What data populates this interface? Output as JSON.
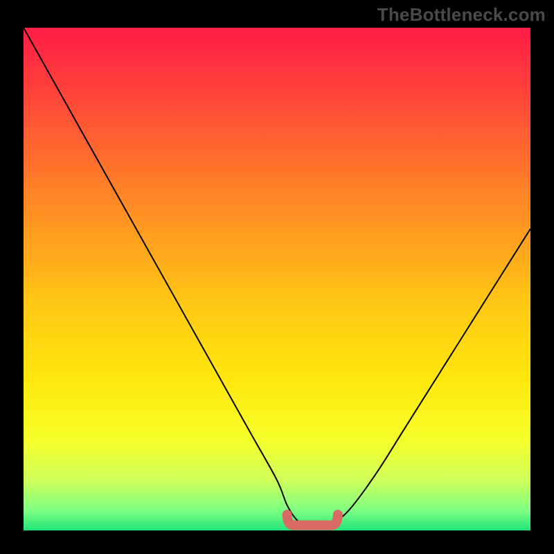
{
  "attribution": "TheBottleneck.com",
  "chart_data": {
    "type": "line",
    "title": "",
    "xlabel": "",
    "ylabel": "",
    "xlim": [
      0,
      100
    ],
    "ylim": [
      0,
      100
    ],
    "x": [
      0,
      5,
      10,
      15,
      20,
      25,
      30,
      35,
      40,
      45,
      50,
      52,
      54,
      56,
      58,
      60,
      62,
      65,
      70,
      75,
      80,
      85,
      90,
      95,
      100
    ],
    "values": [
      100,
      91,
      82,
      73,
      64,
      55,
      46,
      37,
      28,
      19,
      10,
      5,
      2,
      1,
      1,
      1,
      2,
      5,
      12,
      20,
      28,
      36,
      44,
      52,
      60
    ],
    "flat_band_x": [
      52,
      62
    ],
    "flat_band_y": 2,
    "gradient_stops": [
      {
        "offset": 0.0,
        "color": "#ff1c45"
      },
      {
        "offset": 0.1,
        "color": "#ff3a3d"
      },
      {
        "offset": 0.25,
        "color": "#ff6a2e"
      },
      {
        "offset": 0.4,
        "color": "#ff9a20"
      },
      {
        "offset": 0.55,
        "color": "#ffc814"
      },
      {
        "offset": 0.7,
        "color": "#ffe70e"
      },
      {
        "offset": 0.82,
        "color": "#f6ff2a"
      },
      {
        "offset": 0.9,
        "color": "#cfff5a"
      },
      {
        "offset": 0.96,
        "color": "#7fff82"
      },
      {
        "offset": 1.0,
        "color": "#20e57a"
      }
    ],
    "marker_color": "#d96a63",
    "curve_color": "#000000"
  }
}
